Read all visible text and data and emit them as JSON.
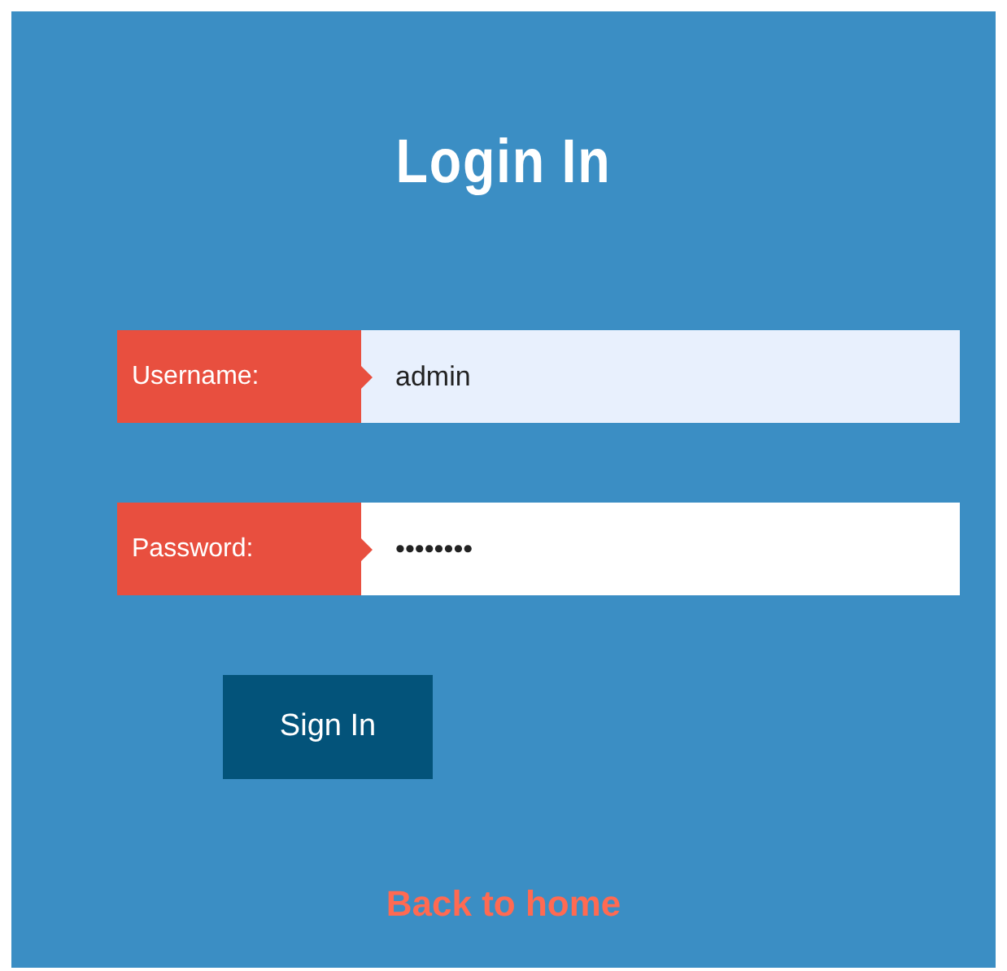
{
  "title": "Login In",
  "fields": [
    {
      "label": "Username:",
      "value": "admin",
      "autofilled": true
    },
    {
      "label": "Password:",
      "value": "••••••••",
      "autofilled": false
    }
  ],
  "submit_button": "Sign In",
  "back_link": "Back to home"
}
